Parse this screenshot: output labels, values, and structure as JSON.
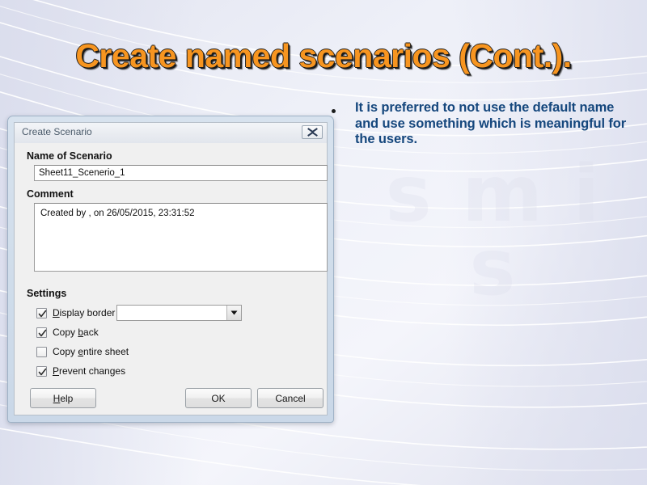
{
  "slide": {
    "title": "Create named scenarios (Cont.).",
    "title_color": "#F79520",
    "background_color": "#e9eaf4",
    "watermark_text": "s m i s"
  },
  "bullets": [
    {
      "marker": "bullet-dot",
      "text": "It is preferred to not use the default name and use something which is meaningful for the users.",
      "color": "#15477d"
    }
  ],
  "dialog": {
    "title": "Create Scenario",
    "close_icon": "close-icon",
    "name_section": {
      "label": "Name of Scenario",
      "value": "Sheet11_Scenerio_1",
      "placeholder": ""
    },
    "comment_section": {
      "label": "Comment",
      "value": "Created by , on 26/05/2015, 23:31:52",
      "placeholder": ""
    },
    "settings_section": {
      "label": "Settings",
      "checkboxes": [
        {
          "label_pre": "",
          "accel": "D",
          "label_post": "isplay border",
          "checked": true,
          "name": "display-border"
        },
        {
          "label_pre": "Copy ",
          "accel": "b",
          "label_post": "ack",
          "checked": true,
          "name": "copy-back"
        },
        {
          "label_pre": "Copy ",
          "accel": "e",
          "label_post": "ntire sheet",
          "checked": false,
          "name": "copy-entire-sheet"
        },
        {
          "label_pre": "",
          "accel": "P",
          "label_post": "revent changes",
          "checked": true,
          "name": "prevent-changes"
        }
      ],
      "border_color_select": {
        "value": "",
        "arrow_icon": "chevron-down-icon"
      }
    },
    "buttons": {
      "help": {
        "accel": "H",
        "rest": "elp"
      },
      "ok": "OK",
      "cancel": "Cancel"
    }
  }
}
